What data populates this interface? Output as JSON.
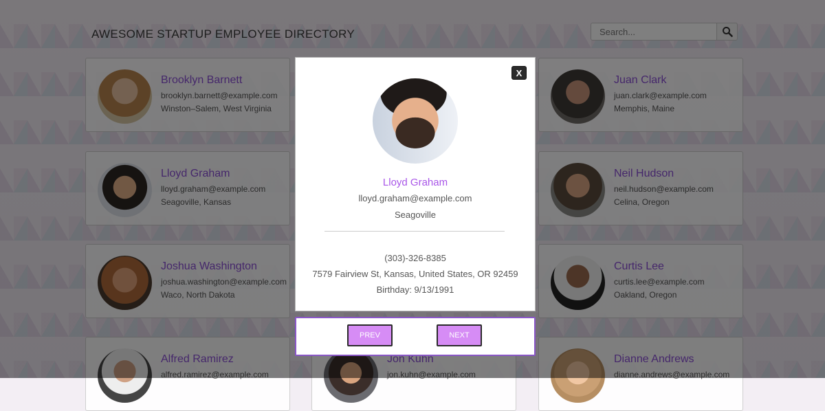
{
  "header": {
    "title": "AWESOME STARTUP EMPLOYEE DIRECTORY",
    "search_placeholder": "Search..."
  },
  "employees": [
    {
      "name": "Brooklyn Barnett",
      "email": "brooklyn.barnett@example.com",
      "location": "Winston–Salem, West Virginia"
    },
    {
      "name": "Juan Clark",
      "email": "juan.clark@example.com",
      "location": "Memphis, Maine"
    },
    {
      "name": "Lloyd Graham",
      "email": "lloyd.graham@example.com",
      "location": "Seagoville, Kansas"
    },
    {
      "name": "Neil Hudson",
      "email": "neil.hudson@example.com",
      "location": "Celina, Oregon"
    },
    {
      "name": "Joshua Washington",
      "email": "joshua.washington@example.com",
      "location": "Waco, North Dakota"
    },
    {
      "name": "Curtis Lee",
      "email": "curtis.lee@example.com",
      "location": "Oakland, Oregon"
    },
    {
      "name": "Alfred Ramirez",
      "email": "alfred.ramirez@example.com",
      "location": ""
    },
    {
      "name": "Jon Kuhn",
      "email": "jon.kuhn@example.com",
      "location": ""
    },
    {
      "name": "Dianne Andrews",
      "email": "dianne.andrews@example.com",
      "location": ""
    }
  ],
  "modal": {
    "close_label": "X",
    "name": "Lloyd Graham",
    "email": "lloyd.graham@example.com",
    "city": "Seagoville",
    "phone": "(303)-326-8385",
    "address": "7579 Fairview St, Kansas, United States, OR 92459",
    "birthday": "Birthday: 9/13/1991"
  },
  "nav": {
    "prev_label": "PREV",
    "next_label": "NEXT"
  },
  "colors": {
    "accent": "#8b4fd6",
    "modal_name": "#a855e8",
    "button_bg": "#d68cf5"
  }
}
